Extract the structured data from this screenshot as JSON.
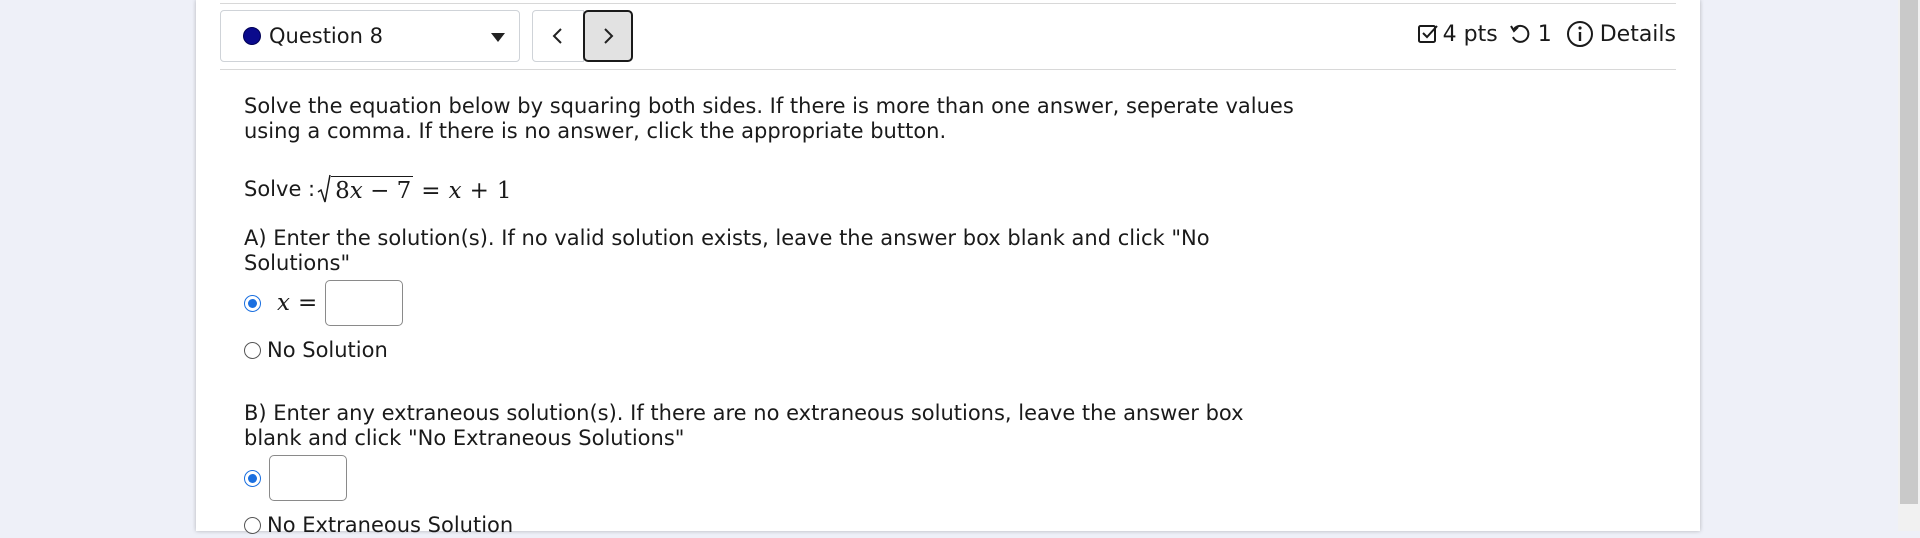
{
  "header": {
    "question_label": "Question 8",
    "points": "4 pts",
    "attempts": "1",
    "details": "Details"
  },
  "question": {
    "instructions": "Solve the equation below by squaring both sides. If there is more than one answer, seperate values using a comma. If there is no answer, click the appropriate button.",
    "solve_prefix": "Solve :",
    "equation": {
      "radicand_coef": "8",
      "var": "x",
      "minus": "−",
      "const": "7",
      "equals": "=",
      "rhs_var": "x",
      "plus": "+",
      "rhs_const": "1"
    },
    "part_a": {
      "prompt": "A) Enter the solution(s). If no valid solution exists, leave the answer box blank and click \"No Solutions\"",
      "var": "x",
      "equals": "=",
      "answer_value": "",
      "no_solution_label": "No Solution"
    },
    "part_b": {
      "prompt": "B) Enter any extraneous solution(s). If there are no extraneous solutions, leave the answer box blank and click \"No Extraneous Solutions\"",
      "answer_value": "",
      "no_solution_label": "No Extraneous Solution"
    }
  },
  "colors": {
    "status_dot": "#0a0a8c",
    "radio_selected": "#1a6fe0"
  },
  "icons": {
    "prev": "chevron-left-icon",
    "next": "chevron-right-icon",
    "points": "checkbox-icon",
    "attempts": "retry-icon",
    "details": "info-icon",
    "dropdown": "caret-down-icon"
  }
}
